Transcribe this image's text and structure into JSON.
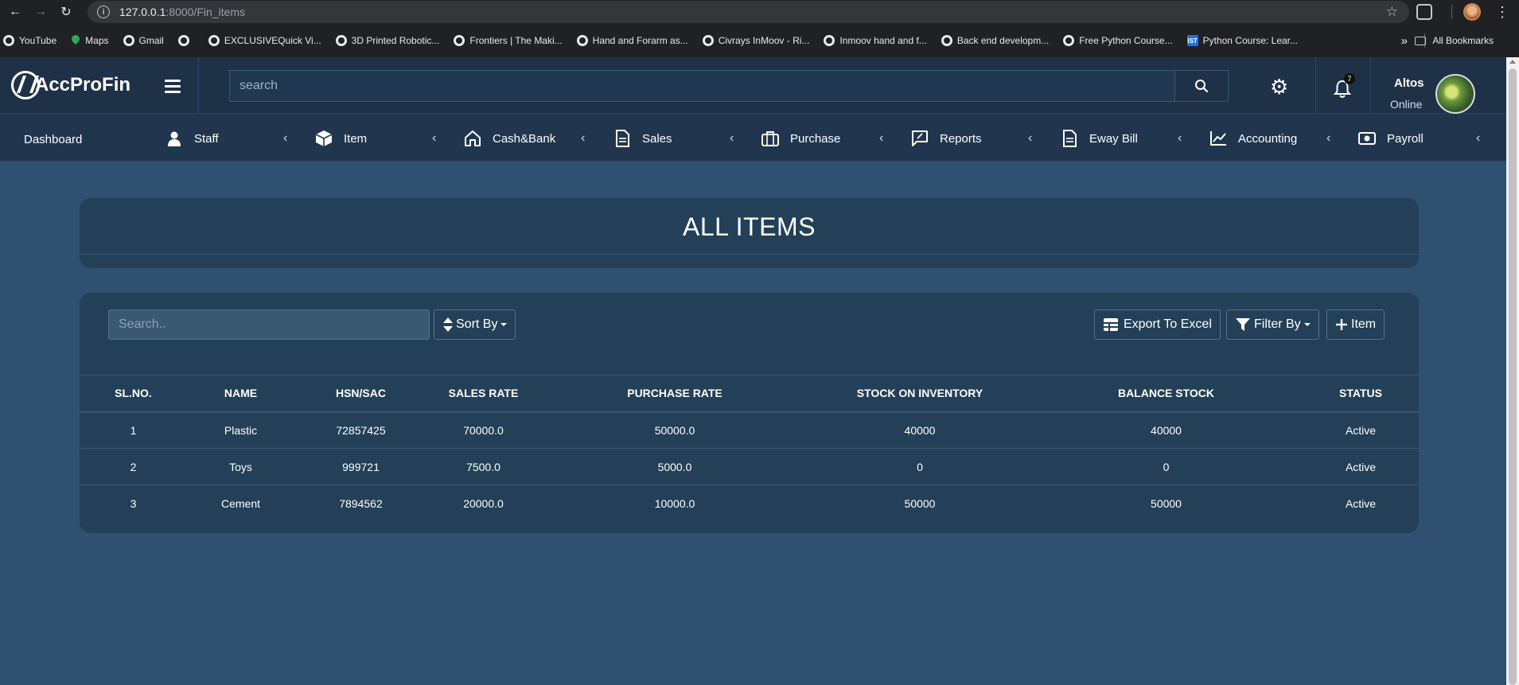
{
  "browser": {
    "url_host": "127.0.0.1",
    "url_path": ":8000/Fin_items",
    "bookmarks": [
      {
        "label": "YouTube"
      },
      {
        "label": "Maps"
      },
      {
        "label": "Gmail"
      },
      {
        "label": ""
      },
      {
        "label": "EXCLUSIVEQuick Vi..."
      },
      {
        "label": "3D Printed Robotic..."
      },
      {
        "label": "Frontiers | The Maki..."
      },
      {
        "label": "Hand and Forarm as..."
      },
      {
        "label": "Civrays InMoov - Ri..."
      },
      {
        "label": "Inmoov hand and f..."
      },
      {
        "label": "Back end developm..."
      },
      {
        "label": "Free Python Course..."
      },
      {
        "label": "Python Course: Lear..."
      }
    ],
    "all_bookmarks": "All Bookmarks",
    "ist_badge": "IST"
  },
  "header": {
    "logo_text": "AccProFin",
    "search_placeholder": "search",
    "notification_count": "7",
    "user_name": "Altos",
    "user_status": "Online"
  },
  "nav": {
    "dashboard": "Dashboard",
    "items": [
      {
        "label": "Staff",
        "icon": "user-icon"
      },
      {
        "label": "Item",
        "icon": "box-icon"
      },
      {
        "label": "Cash&Bank",
        "icon": "home-icon"
      },
      {
        "label": "Sales",
        "icon": "document-icon"
      },
      {
        "label": "Purchase",
        "icon": "briefcase-icon"
      },
      {
        "label": "Reports",
        "icon": "chat-edit-icon"
      },
      {
        "label": "Eway Bill",
        "icon": "document-icon"
      },
      {
        "label": "Accounting",
        "icon": "chart-line-icon"
      },
      {
        "label": "Payroll",
        "icon": "money-icon"
      }
    ]
  },
  "page": {
    "title": "ALL ITEMS",
    "search_placeholder": "Search..",
    "sort_label": "Sort By",
    "export_label": "Export To Excel",
    "filter_label": "Filter By",
    "add_item_label": "Item"
  },
  "table": {
    "headers": [
      "SL.NO.",
      "NAME",
      "HSN/SAC",
      "SALES RATE",
      "PURCHASE RATE",
      "STOCK ON INVENTORY",
      "BALANCE STOCK",
      "STATUS"
    ],
    "rows": [
      [
        "1",
        "Plastic",
        "72857425",
        "70000.0",
        "50000.0",
        "40000",
        "40000",
        "Active"
      ],
      [
        "2",
        "Toys",
        "999721",
        "7500.0",
        "5000.0",
        "0",
        "0",
        "Active"
      ],
      [
        "3",
        "Cement",
        "7894562",
        "20000.0",
        "10000.0",
        "50000",
        "50000",
        "Active"
      ]
    ]
  }
}
